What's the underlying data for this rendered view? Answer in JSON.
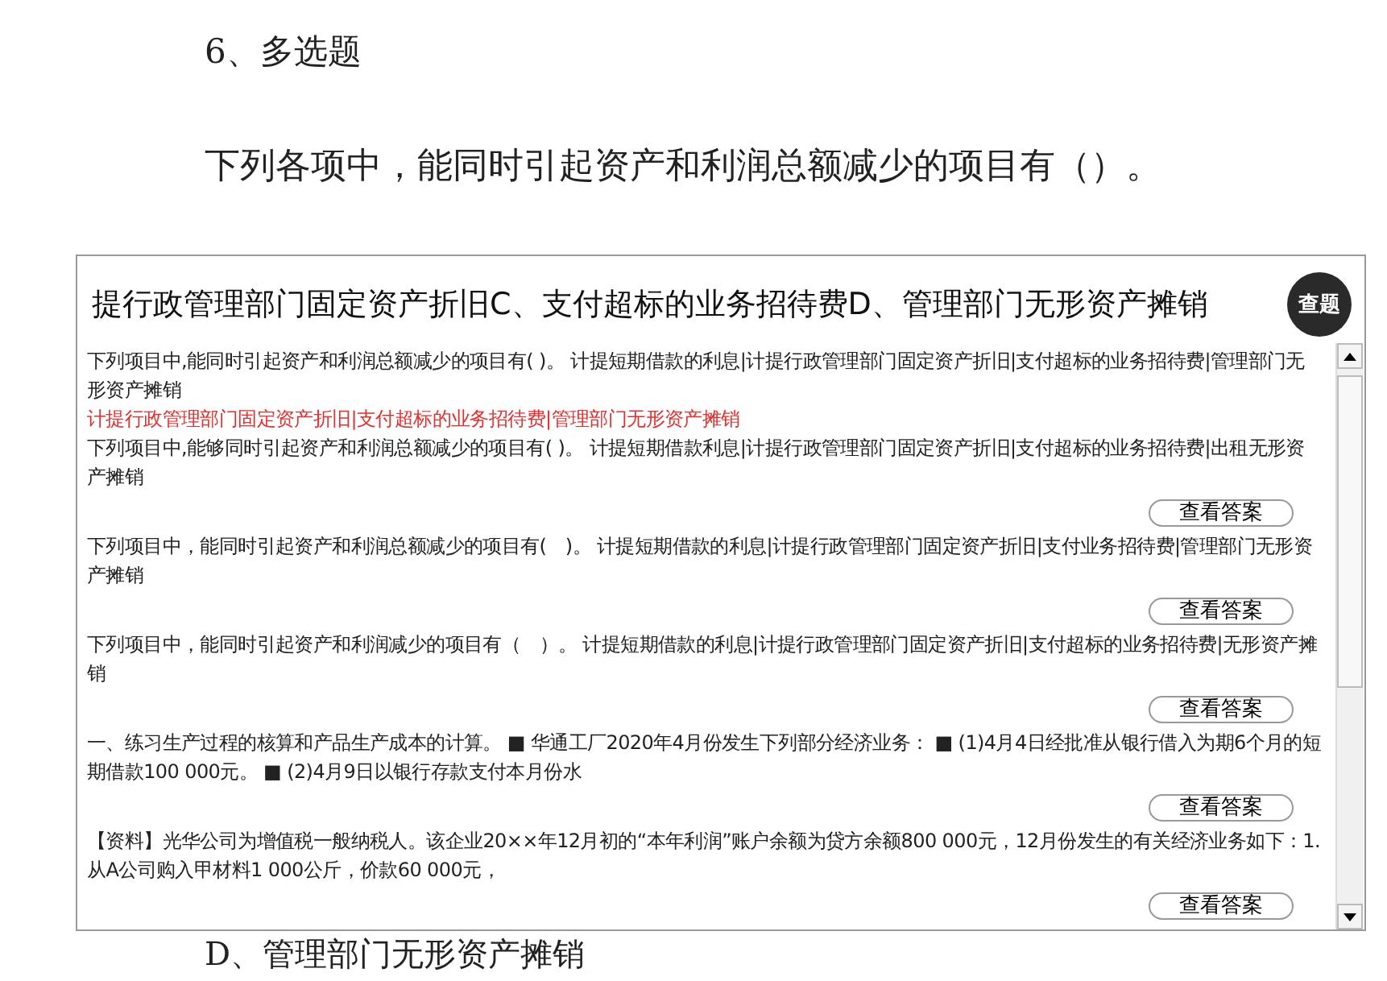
{
  "document": {
    "heading": "6、多选题",
    "question": "下列各项中，能同时引起资产和利润总额减少的项目有（）。",
    "option_d": "D、管理部门无形资产摊销"
  },
  "popup": {
    "title": "提行政管理部门固定资产折旧C、支付超标的业务招待费D、管理部门无形资产摊销",
    "search_badge": "查题",
    "results": [
      {
        "text": "下列项目中,能同时引起资产和利润总额减少的项目有( )。 计提短期借款的利息|计提行政管理部门固定资产折旧|支付超标的业务招待费|管理部门无形资产摊销",
        "answer": "计提行政管理部门固定资产折旧|支付超标的业务招待费|管理部门无形资产摊销"
      },
      {
        "text": "下列项目中,能够同时引起资产和利润总额减少的项目有( )。 计提短期借款利息|计提行政管理部门固定资产折旧|支付超标的业务招待费|出租无形资产摊销",
        "button": "查看答案"
      },
      {
        "text": "下列项目中，能同时引起资产和利润总额减少的项目有(　)。 计提短期借款的利息|计提行政管理部门固定资产折旧|支付业务招待费|管理部门无形资产摊销",
        "button": "查看答案"
      },
      {
        "text": "下列项目中，能同时引起资产和利润减少的项目有（　）。 计提短期借款的利息|计提行政管理部门固定资产折旧|支付超标的业务招待费|无形资产摊销",
        "button": "查看答案"
      },
      {
        "text": "一、练习生产过程的核算和产品生产成本的计算。 ■ 华通工厂2020年4月份发生下列部分经济业务： ■ (1)4月4日经批准从银行借入为期6个月的短期借款100 000元。 ■ (2)4月9日以银行存款支付本月份水",
        "button": "查看答案"
      },
      {
        "text": "【资料】光华公司为增值税一般纳税人。该企业20××年12月初的“本年利润”账户余额为贷方余额800 000元，12月份发生的有关经济业务如下：1. 从A公司购入甲材料1 000公斤，价款60 000元，",
        "button": "查看答案"
      }
    ]
  }
}
